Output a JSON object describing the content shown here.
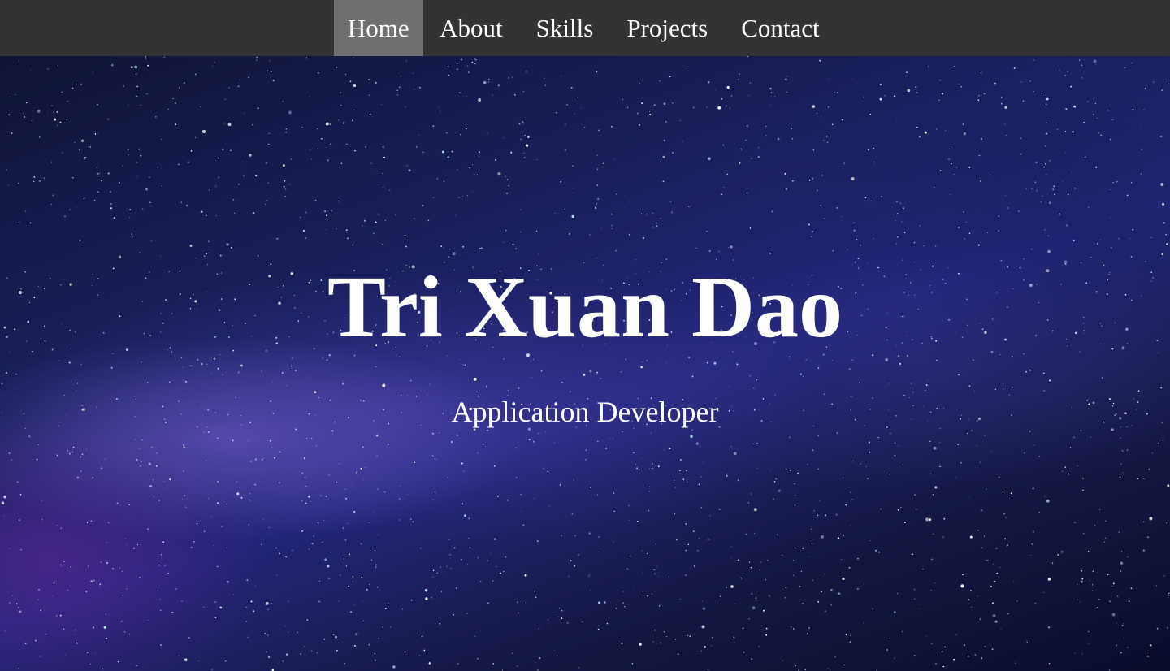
{
  "nav": {
    "items": [
      {
        "label": "Home",
        "active": true
      },
      {
        "label": "About",
        "active": false
      },
      {
        "label": "Skills",
        "active": false
      },
      {
        "label": "Projects",
        "active": false
      },
      {
        "label": "Contact",
        "active": false
      }
    ]
  },
  "hero": {
    "title": "Tri Xuan Dao",
    "subtitle": "Application Developer"
  },
  "colors": {
    "navbar_bg": "#333333",
    "nav_active_bg": "#6f6f6f",
    "text": "#ffffff"
  }
}
